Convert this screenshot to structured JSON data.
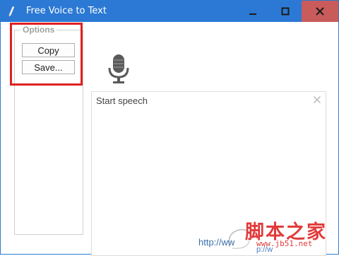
{
  "window": {
    "title": "Free Voice to Text",
    "controls": {
      "minimize_icon": "minimize-icon",
      "maximize_icon": "maximize-icon",
      "close_icon": "close-icon"
    },
    "accent_color": "#2b79d4",
    "close_hover_color": "#c95b5b"
  },
  "options": {
    "legend": "Options",
    "copy_label": "Copy",
    "save_label": "Save..."
  },
  "microphone": {
    "icon": "microphone-icon"
  },
  "speech": {
    "text": "Start speech",
    "clear_icon": "clear-x-icon"
  },
  "watermark": {
    "url_text": "http://ww",
    "url_text_2": "p://w",
    "chinese_text": "脚本之家",
    "site_text": "www.jb51.net",
    "text_color": "#e23a3a"
  }
}
